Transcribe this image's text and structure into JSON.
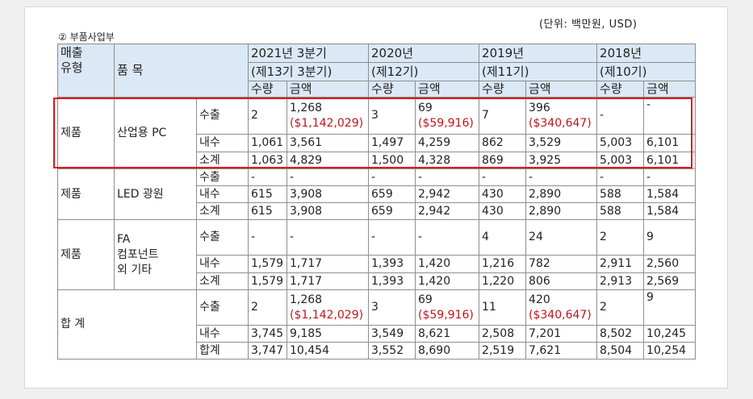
{
  "unit_note": "(단위: 백만원, USD)",
  "caption": "② 부품사업부",
  "header": {
    "sales_type": "매출\n유형",
    "item": "품 목",
    "periods": [
      {
        "year": "2021년 3분기",
        "term": "(제13기 3분기)"
      },
      {
        "year": "2020년",
        "term": "(제12기)"
      },
      {
        "year": "2019년",
        "term": "(제11기)"
      },
      {
        "year": "2018년",
        "term": "(제10기)"
      }
    ],
    "qty": "수량",
    "amount": "금액"
  },
  "groups": [
    {
      "type": "제품",
      "item": "산업용 PC",
      "rows": [
        {
          "label": "수출",
          "cells": [
            {
              "q": "2",
              "a": "1,268",
              "a2": "($1,142,029)"
            },
            {
              "q": "3",
              "a": "69",
              "a2": "($59,916)"
            },
            {
              "q": "7",
              "a": "396",
              "a2": "($340,647)"
            },
            {
              "q": "-",
              "a": "-",
              "a2": ""
            }
          ]
        },
        {
          "label": "내수",
          "cells": [
            {
              "q": "1,061",
              "a": "3,561"
            },
            {
              "q": "1,497",
              "a": "4,259"
            },
            {
              "q": "862",
              "a": "3,529"
            },
            {
              "q": "5,003",
              "a": "6,101"
            }
          ]
        },
        {
          "label": "소계",
          "cells": [
            {
              "q": "1,063",
              "a": "4,829"
            },
            {
              "q": "1,500",
              "a": "4,328"
            },
            {
              "q": "869",
              "a": "3,925"
            },
            {
              "q": "5,003",
              "a": "6,101"
            }
          ]
        }
      ]
    },
    {
      "type": "제품",
      "item": "LED 광원",
      "rows": [
        {
          "label": "수출",
          "cells": [
            {
              "q": "-",
              "a": "-"
            },
            {
              "q": "-",
              "a": "-"
            },
            {
              "q": "-",
              "a": "-"
            },
            {
              "q": "-",
              "a": "-"
            }
          ]
        },
        {
          "label": "내수",
          "cells": [
            {
              "q": "615",
              "a": "3,908"
            },
            {
              "q": "659",
              "a": "2,942"
            },
            {
              "q": "430",
              "a": "2,890"
            },
            {
              "q": "588",
              "a": "1,584"
            }
          ]
        },
        {
          "label": "소계",
          "cells": [
            {
              "q": "615",
              "a": "3,908"
            },
            {
              "q": "659",
              "a": "2,942"
            },
            {
              "q": "430",
              "a": "2,890"
            },
            {
              "q": "588",
              "a": "1,584"
            }
          ]
        }
      ]
    },
    {
      "type": "제품",
      "item": "FA\n컴포넌트\n외 기타",
      "rows": [
        {
          "label": "수출",
          "cells": [
            {
              "q": "-",
              "a": "-"
            },
            {
              "q": "-",
              "a": "-"
            },
            {
              "q": "4",
              "a": "24"
            },
            {
              "q": "2",
              "a": "9"
            }
          ]
        },
        {
          "label": "내수",
          "cells": [
            {
              "q": "1,579",
              "a": "1,717"
            },
            {
              "q": "1,393",
              "a": "1,420"
            },
            {
              "q": "1,216",
              "a": "782"
            },
            {
              "q": "2,911",
              "a": "2,560"
            }
          ]
        },
        {
          "label": "소계",
          "cells": [
            {
              "q": "1,579",
              "a": "1,717"
            },
            {
              "q": "1,393",
              "a": "1,420"
            },
            {
              "q": "1,220",
              "a": "806"
            },
            {
              "q": "2,913",
              "a": "2,569"
            }
          ]
        }
      ]
    },
    {
      "type": "합 계",
      "item": "",
      "rows": [
        {
          "label": "수출",
          "cells": [
            {
              "q": "2",
              "a": "1,268",
              "a2": "($1,142,029)"
            },
            {
              "q": "3",
              "a": "69",
              "a2": "($59,916)"
            },
            {
              "q": "11",
              "a": "420",
              "a2": "($340,647)"
            },
            {
              "q": "2",
              "a": "9",
              "a2": ""
            }
          ]
        },
        {
          "label": "내수",
          "cells": [
            {
              "q": "3,745",
              "a": "9,185"
            },
            {
              "q": "3,549",
              "a": "8,621"
            },
            {
              "q": "2,508",
              "a": "7,201"
            },
            {
              "q": "8,502",
              "a": "10,245"
            }
          ]
        },
        {
          "label": "합계",
          "cells": [
            {
              "q": "3,747",
              "a": "10,454"
            },
            {
              "q": "3,552",
              "a": "8,690"
            },
            {
              "q": "2,519",
              "a": "7,621"
            },
            {
              "q": "8,504",
              "a": "10,254"
            }
          ]
        }
      ]
    }
  ],
  "colors": {
    "header_bg": "#dbe8f5",
    "usd_text": "#c0141c",
    "highlight_border": "#e0101c"
  }
}
